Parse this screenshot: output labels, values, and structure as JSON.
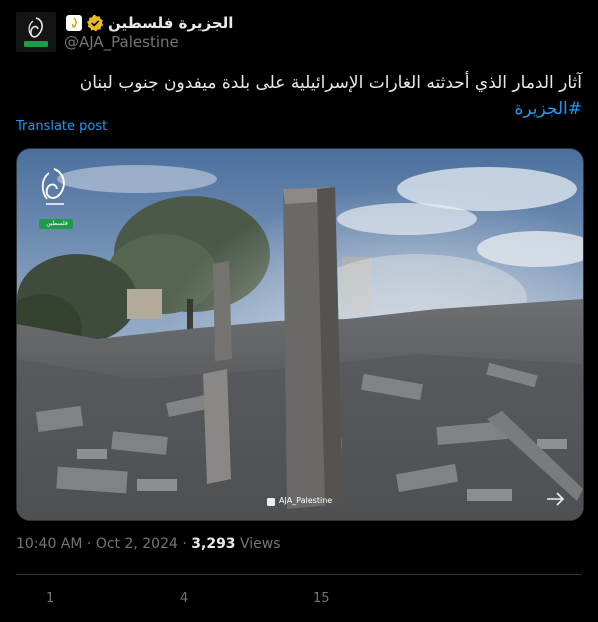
{
  "account": {
    "display_name": "الجزيرة فلسطين",
    "handle": "@AJA_Palestine"
  },
  "tweet": {
    "text": "آثار الدمار الذي أحدثته الغارات الإسرائيلية على بلدة ميفدون جنوب لبنان",
    "hashtag": "#الجزيرة",
    "translate_label": "Translate post"
  },
  "media": {
    "watermark_logo_caption": "فلسطين",
    "watermark_handle": "AJA_Palestine"
  },
  "meta": {
    "time": "10:40 AM",
    "separator": "·",
    "date": "Oct 2, 2024",
    "separator2": "·",
    "views_count": "3,293",
    "views_label": "Views"
  },
  "actions": {
    "replies": "1",
    "reposts": "4",
    "likes": "15"
  },
  "colors": {
    "accent": "#1d9bf0",
    "muted": "#71767b",
    "verified_gold": "#e8b829"
  }
}
